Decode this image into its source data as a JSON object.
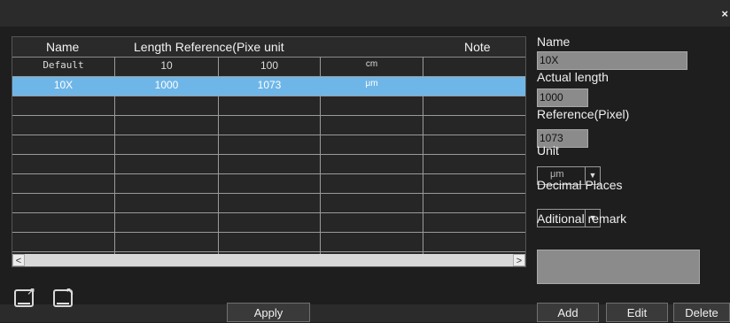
{
  "window": {
    "close_glyph": "×"
  },
  "table": {
    "headers": {
      "name": "Name",
      "length_reference": "Length Reference(Pixe unit",
      "note": "Note"
    },
    "rows": [
      {
        "name": "Default",
        "actual_length": "10",
        "reference_pixel": "100",
        "unit": "cm",
        "note": ""
      },
      {
        "name": "10X",
        "actual_length": "1000",
        "reference_pixel": "1073",
        "unit": "μm",
        "note": ""
      }
    ],
    "selected_row": 1,
    "scroll_left": "<",
    "scroll_right": ">"
  },
  "form": {
    "name_label": "Name",
    "name_value": "10X",
    "actual_length_label": "Actual length",
    "actual_length_value": "1000",
    "reference_label": "Reference(Pixel)",
    "reference_value": "1073",
    "unit_label": "Unit",
    "unit_value": "μm",
    "decimal_places_label": "Decimal Places",
    "remark_label": "Aditional remark"
  },
  "buttons": {
    "apply": "Apply",
    "add": "Add",
    "edit": "Edit",
    "delete": "Delete"
  },
  "icons": {
    "export": "export-icon",
    "import": "import-icon"
  }
}
